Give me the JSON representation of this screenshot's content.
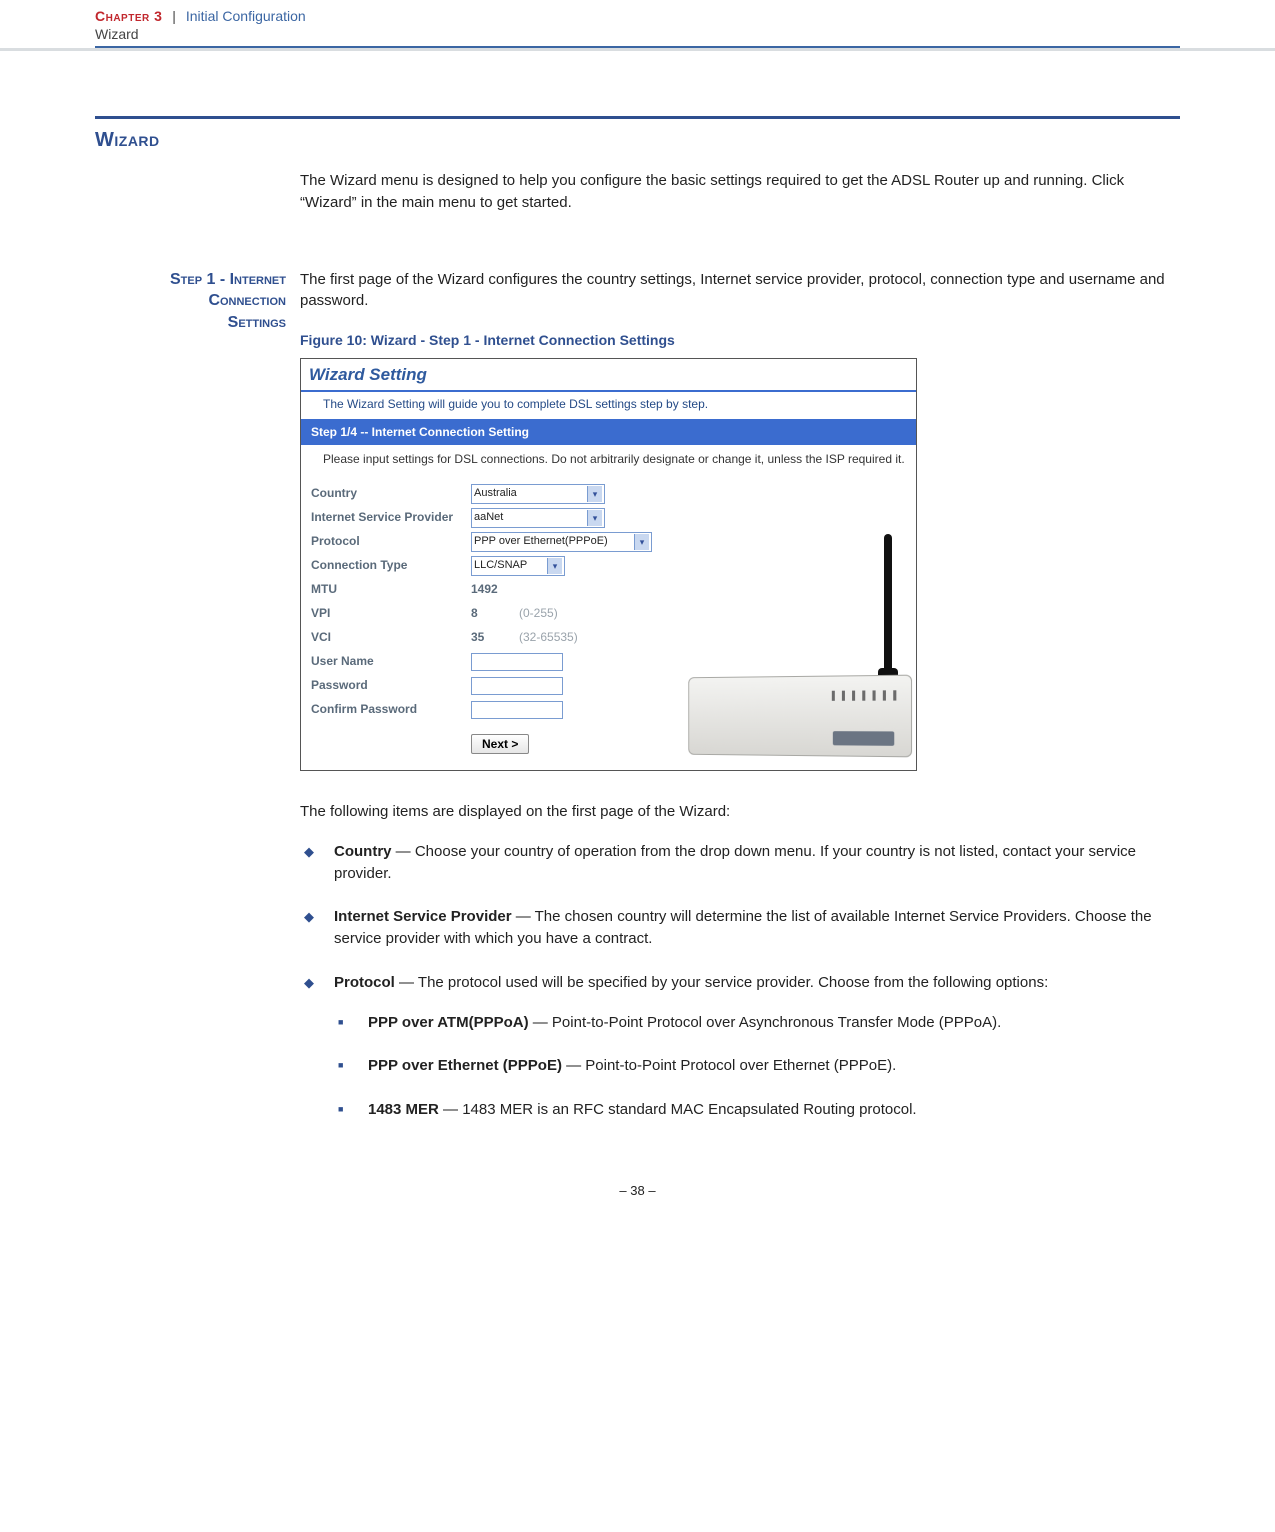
{
  "header": {
    "chapter_label": "Chapter 3",
    "chapter_title": "Initial Configuration",
    "sub": "Wizard"
  },
  "section": {
    "title": "Wizard",
    "intro": "The Wizard menu is designed to help you configure the basic settings required to get the ADSL Router up and running. Click “Wizard” in the main menu to get started."
  },
  "step1": {
    "side_label_l1": "Step 1 - Internet",
    "side_label_l2": "Connection",
    "side_label_l3": "Settings",
    "para": "The first page of the Wizard configures the country settings, Internet service provider, protocol, connection type and username and password.",
    "figure_caption": "Figure 10:  Wizard - Step 1 - Internet Connection Settings"
  },
  "screenshot": {
    "title": "Wizard Setting",
    "subtitle": "The Wizard Setting will guide you to complete DSL settings step by step.",
    "step_bar": "Step 1/4 -- Internet Connection Setting",
    "instruction": "Please input settings for DSL connections. Do not arbitrarily designate or change it, unless the ISP required it.",
    "labels": {
      "country": "Country",
      "isp": "Internet Service Provider",
      "protocol": "Protocol",
      "conn_type": "Connection Type",
      "mtu": "MTU",
      "vpi": "VPI",
      "vci": "VCI",
      "username": "User Name",
      "password": "Password",
      "confirm": "Confirm Password"
    },
    "values": {
      "country": "Australia",
      "isp": "aaNet",
      "protocol": "PPP over Ethernet(PPPoE)",
      "conn_type": "LLC/SNAP",
      "mtu": "1492",
      "vpi": "8",
      "vpi_range": "(0-255)",
      "vci": "35",
      "vci_range": "(32-65535)"
    },
    "next_btn": "Next >"
  },
  "displayed_intro": "The following items are displayed on the first page of the Wizard:",
  "items": {
    "country": {
      "label": "Country",
      "desc": " — Choose your country of operation from the drop down menu. If your country is not listed, contact your service provider."
    },
    "isp": {
      "label": "Internet Service Provider",
      "desc": " — The chosen country will determine the list of available Internet Service Providers. Choose the service provider with which you have a contract."
    },
    "protocol": {
      "label": "Protocol",
      "desc": " — The protocol used will be specified by your service provider. Choose from the following options:",
      "sub": {
        "pppoa": {
          "label": "PPP over ATM(PPPoA)",
          "desc": " — Point-to-Point Protocol over Asynchronous Transfer Mode (PPPoA)."
        },
        "pppoe": {
          "label": "PPP over Ethernet (PPPoE)",
          "desc": " — Point-to-Point Protocol over Ethernet (PPPoE)."
        },
        "mer": {
          "label": "1483 MER",
          "desc": " — 1483 MER is an RFC standard MAC Encapsulated Routing protocol."
        }
      }
    }
  },
  "page_number": "–  38  –"
}
